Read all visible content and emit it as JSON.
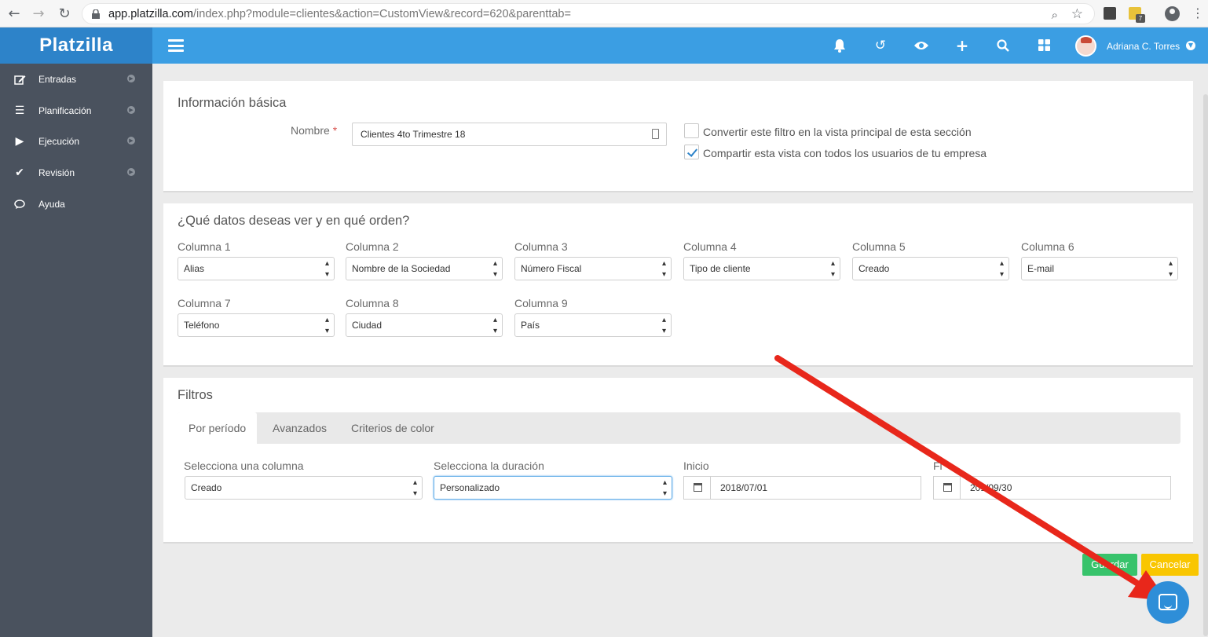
{
  "browser": {
    "url_host": "app.platzilla.com",
    "url_path": "/index.php?module=clientes&action=CustomView&record=620&parenttab=",
    "ext_badge": "7"
  },
  "brand": "Platzilla",
  "user": {
    "name": "Adriana C. Torres"
  },
  "sidebar": {
    "items": [
      {
        "label": "Entradas",
        "icon": "edit-icon"
      },
      {
        "label": "Planificación",
        "icon": "list-icon"
      },
      {
        "label": "Ejecución",
        "icon": "play-icon"
      },
      {
        "label": "Revisión",
        "icon": "check-icon"
      },
      {
        "label": "Ayuda",
        "icon": "chat-icon"
      }
    ]
  },
  "basic": {
    "title": "Información básica",
    "name_label": "Nombre",
    "required_mark": "*",
    "name_value": "Clientes 4to Trimestre 18",
    "default_view_label": "Convertir este filtro en la vista principal de esta sección",
    "default_view_checked": false,
    "share_label": "Compartir esta vista con todos los usuarios de tu empresa",
    "share_checked": true
  },
  "columns": {
    "title": "¿Qué datos deseas ver y en qué orden?",
    "items": [
      {
        "label": "Columna 1",
        "value": "Alias"
      },
      {
        "label": "Columna 2",
        "value": "Nombre de la Sociedad"
      },
      {
        "label": "Columna 3",
        "value": "Número Fiscal"
      },
      {
        "label": "Columna 4",
        "value": "Tipo de cliente"
      },
      {
        "label": "Columna 5",
        "value": "Creado"
      },
      {
        "label": "Columna 6",
        "value": "E-mail"
      },
      {
        "label": "Columna 7",
        "value": "Teléfono"
      },
      {
        "label": "Columna 8",
        "value": "Ciudad"
      },
      {
        "label": "Columna 9",
        "value": "País"
      }
    ]
  },
  "filters": {
    "title": "Filtros",
    "tabs": [
      "Por período",
      "Avanzados",
      "Criterios de color"
    ],
    "column_label": "Selecciona una columna",
    "column_value": "Creado",
    "duration_label": "Selecciona la duración",
    "duration_value": "Personalizado",
    "start_label": "Inicio",
    "start_value": "2018/07/01",
    "end_label": "Fi",
    "end_value_visible": "201",
    "end_value_visible2": "/09/30"
  },
  "actions": {
    "save": "Guardar",
    "cancel": "Cancelar"
  },
  "colors": {
    "primary": "#3b9ee3",
    "brand_dark": "#2d83c9",
    "sidebar": "#4a525e",
    "save": "#37c36b",
    "cancel": "#f9c600",
    "annotation_arrow": "#e8271b"
  }
}
